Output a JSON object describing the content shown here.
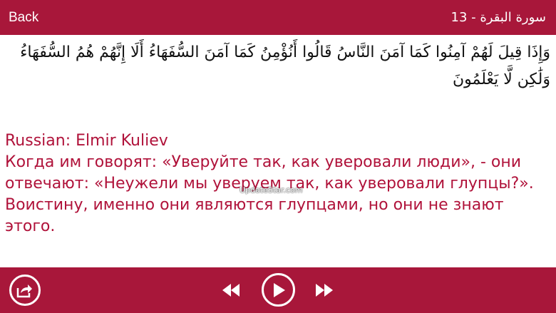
{
  "header": {
    "back_label": "Back",
    "surah_title": "سورة البقرة - 13"
  },
  "verse": {
    "arabic": "وَإِذَا قِيلَ لَهُمْ آمِنُوا كَمَا آمَنَ النَّاسُ قَالُوا أَنُؤْمِنُ كَمَا آمَنَ السُّفَهَاءُ أَلَا إِنَّهُمْ هُمُ السُّفَهَاءُ وَلَٰكِن لَّا يَعْلَمُونَ",
    "translator": "Russian: Elmir Kuliev",
    "translation": "Когда им говорят: «Уверуйте так, как уверовали люди», - они отвечают: «Неужели мы уверуем так, как уверовали глупцы?». Воистину, именно они являются глупцами, но они не знают этого."
  },
  "watermark": "UpdateStar.com",
  "footer": {
    "icons": [
      "share-icon",
      "rewind-icon",
      "play-icon",
      "fast-forward-icon"
    ]
  },
  "colors": {
    "bar": "#a8173a",
    "translation_text": "#b0123a",
    "arabic_text": "#111111"
  }
}
